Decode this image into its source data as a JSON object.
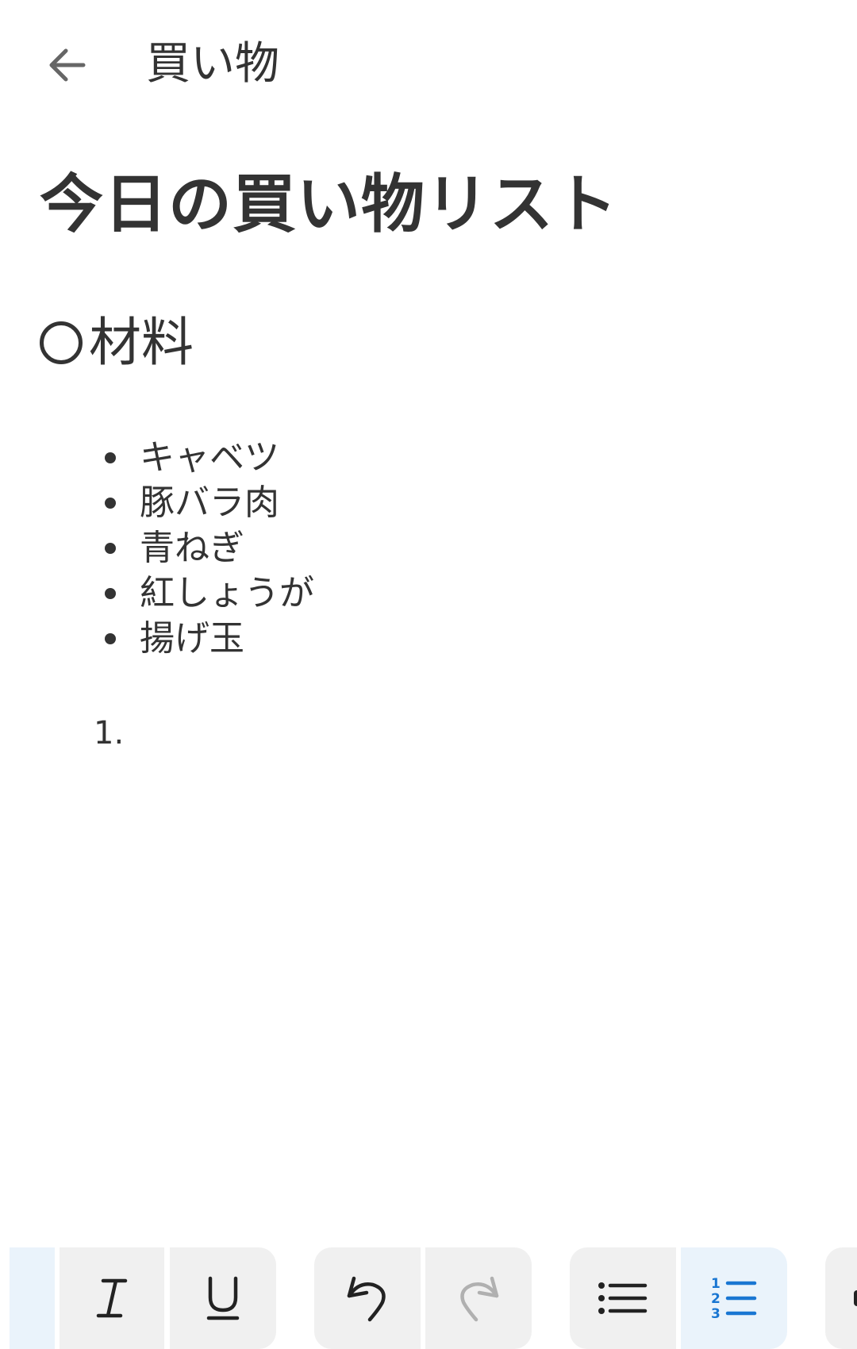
{
  "header": {
    "title": "買い物"
  },
  "document": {
    "title": "今日の買い物リスト",
    "section_heading": "材料",
    "bullet_items": [
      "キャベツ",
      "豚バラ肉",
      "青ねぎ",
      "紅しょうが",
      "揚げ玉"
    ],
    "numbered_items": [
      {
        "marker": "1.",
        "text": ""
      }
    ]
  },
  "toolbar": {
    "buttons": [
      {
        "name": "bold-button",
        "icon": "bold-icon",
        "state": "active"
      },
      {
        "name": "italic-button",
        "icon": "italic-icon",
        "state": "normal"
      },
      {
        "name": "underline-button",
        "icon": "underline-icon",
        "state": "normal"
      },
      {
        "name": "undo-button",
        "icon": "undo-icon",
        "state": "normal"
      },
      {
        "name": "redo-button",
        "icon": "redo-icon",
        "state": "disabled"
      },
      {
        "name": "bulleted-list-button",
        "icon": "bulleted-list-icon",
        "state": "normal"
      },
      {
        "name": "numbered-list-button",
        "icon": "numbered-list-icon",
        "state": "active"
      },
      {
        "name": "more-button",
        "icon": "more-icon",
        "state": "normal"
      }
    ]
  },
  "colors": {
    "text": "#333333",
    "accent": "#1976d2",
    "toolbar_button": "#f0f0f0",
    "toolbar_active": "#eaf3fb",
    "disabled_icon": "#b0b0b0"
  }
}
